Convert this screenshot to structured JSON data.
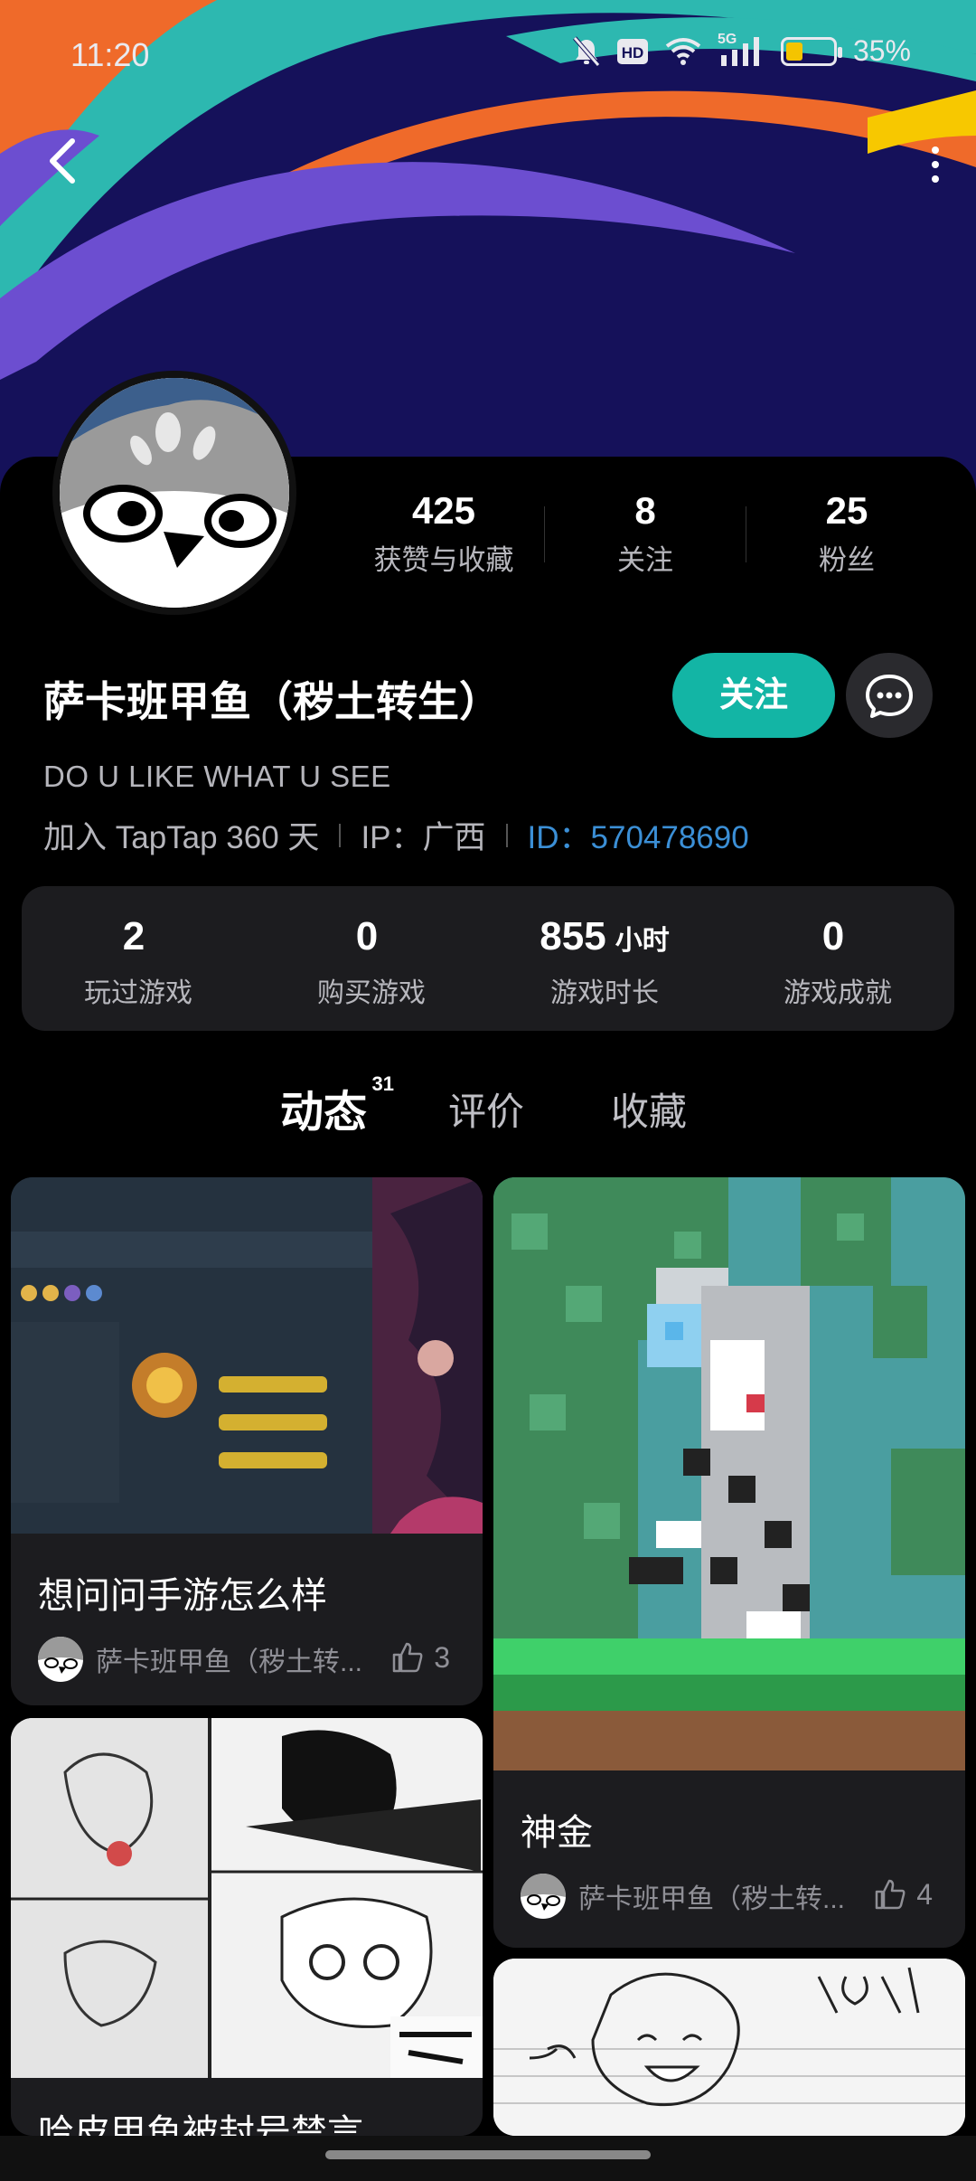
{
  "status_bar": {
    "time": "11:20",
    "network": "5G",
    "battery_text": "35%",
    "battery_level": 0.35,
    "icons": [
      "mute-icon",
      "hd-icon",
      "wifi-icon",
      "signal-icon",
      "battery-icon"
    ]
  },
  "header": {
    "back_icon": "chevron-left-icon",
    "more_icon": "more-vertical-icon"
  },
  "profile": {
    "username": "萨卡班甲鱼（秽土转生）",
    "bio": "DO U LIKE WHAT U SEE",
    "joined": "加入 TapTap 360 天",
    "ip": "IP：广西",
    "id": "ID：570478690",
    "follow_label": "关注",
    "message_icon": "chat-bubble-icon",
    "stats": [
      {
        "num": "425",
        "label": "获赞与收藏"
      },
      {
        "num": "8",
        "label": "关注"
      },
      {
        "num": "25",
        "label": "粉丝"
      }
    ]
  },
  "game_stats": [
    {
      "num": "2",
      "unit": "",
      "label": "玩过游戏"
    },
    {
      "num": "0",
      "unit": "",
      "label": "购买游戏"
    },
    {
      "num": "855",
      "unit": "小时",
      "label": "游戏时长"
    },
    {
      "num": "0",
      "unit": "",
      "label": "游戏成就"
    }
  ],
  "tabs": [
    {
      "label": "动态",
      "count": "31",
      "active": true
    },
    {
      "label": "评价",
      "count": "",
      "active": false
    },
    {
      "label": "收藏",
      "count": "",
      "active": false
    }
  ],
  "posts": [
    {
      "title": "想问问手游怎么样",
      "author": "萨卡班甲鱼（秽土转...",
      "likes": "3"
    },
    {
      "title": "神金",
      "author": "萨卡班甲鱼（秽土转...",
      "likes": "4"
    },
    {
      "title": "哈皮甲鱼被封号禁言",
      "author": "",
      "likes": ""
    }
  ],
  "colors": {
    "accent": "#13b5a5",
    "id_link": "#3b8fd6",
    "card_bg": "#1c1c1f"
  }
}
